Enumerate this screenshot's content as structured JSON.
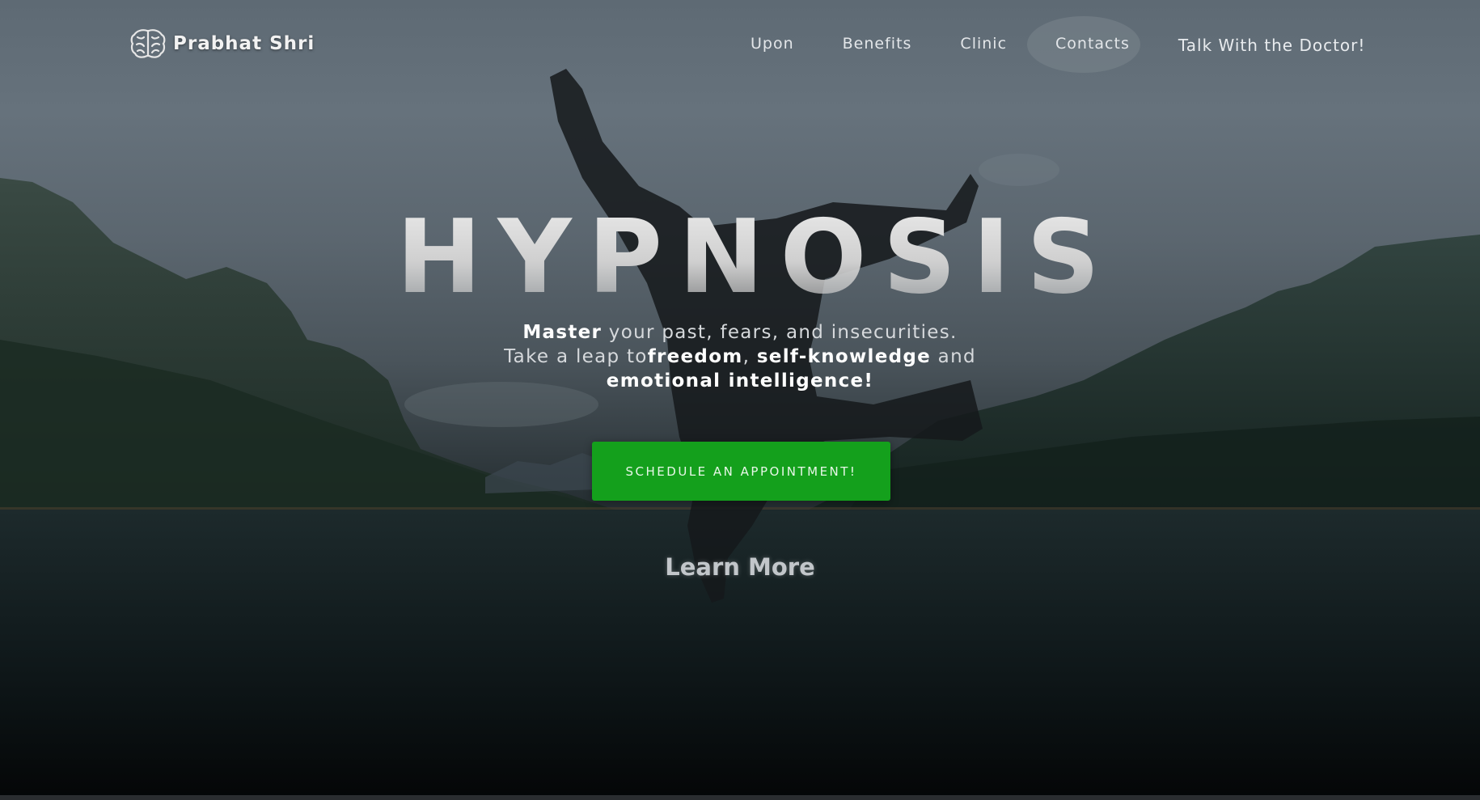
{
  "nav": {
    "logo_text": "Prabhat Shri",
    "logo_icon": "brain-icon",
    "links": [
      "Upon",
      "Benefits",
      "Clinic",
      "Contacts"
    ],
    "cta": "Talk With the Doctor!"
  },
  "hero": {
    "title": "HYPNOSIS",
    "tagline": {
      "line1_bold": "Master",
      "line1_rest": " your past, fears, and insecurities.",
      "line2_start": "Take a leap to",
      "line2_bold1": "freedom",
      "line2_sep": ", ",
      "line2_bold2": "self-knowledge",
      "line2_end": " and",
      "line3_bold": "emotional intelligence!"
    },
    "button_label": "SCHEDULE AN APPOINTMENT!",
    "learn_more": "Learn More"
  },
  "colors": {
    "button": "#14a01c",
    "sky": "#66727c",
    "water": "#0d1417"
  }
}
